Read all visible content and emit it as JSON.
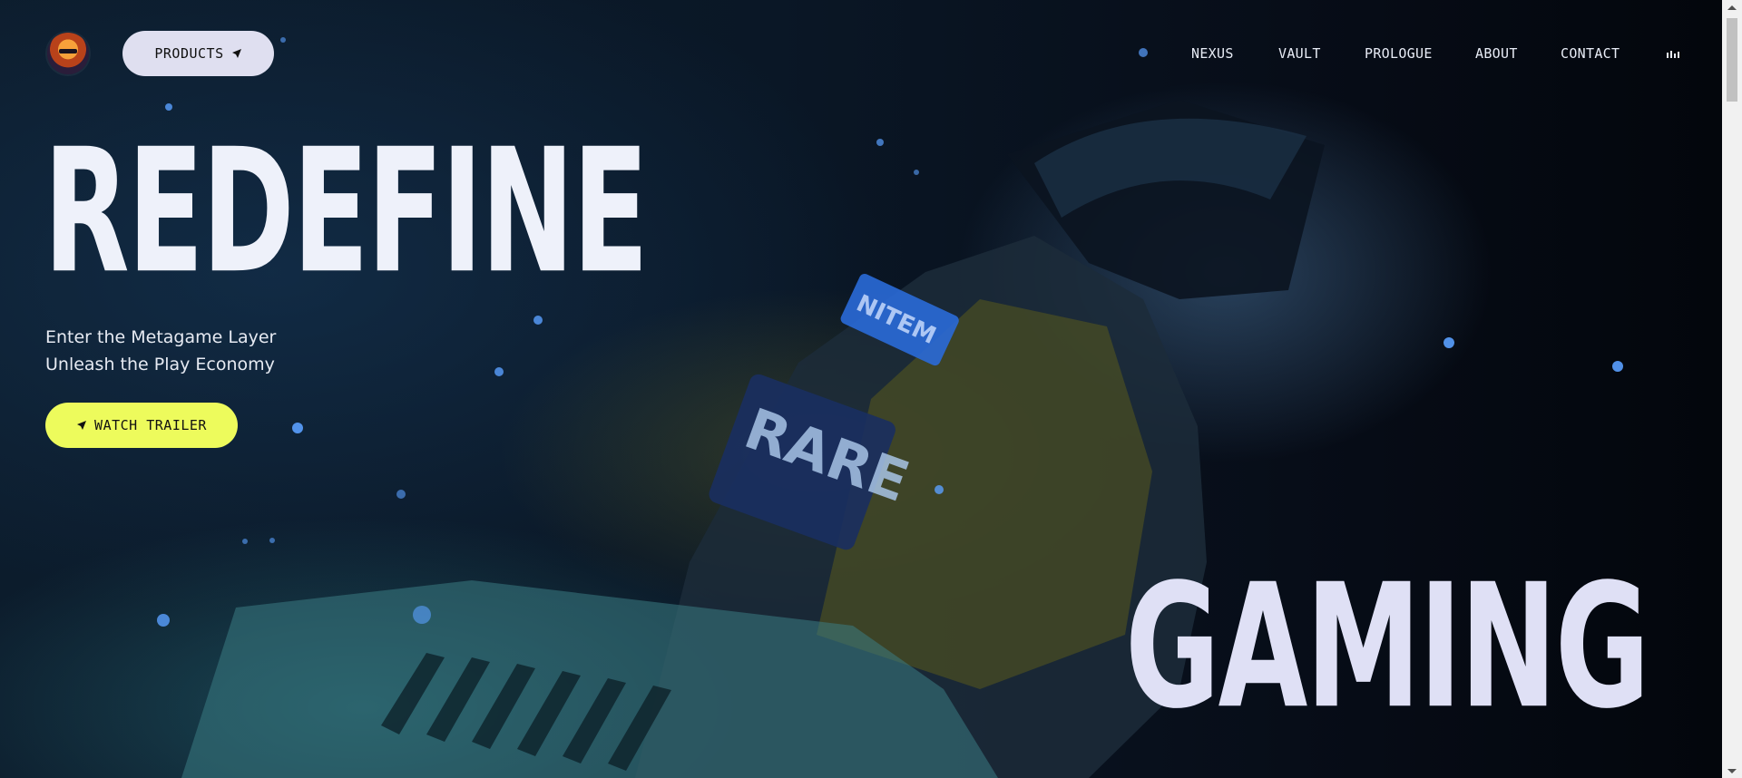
{
  "colors": {
    "heading_primary": "#eef1fa",
    "heading_secondary": "#dfe0f5",
    "products_button_bg": "#dfdff0",
    "trailer_button_bg": "#edfb5c",
    "nav_text": "#e8ecf6"
  },
  "header": {
    "logo_icon": "ninja-avatar-icon",
    "products_label": "PRODUCTS",
    "products_icon": "arrow-icon",
    "nav": [
      "NEXUS",
      "VAULT",
      "PROLOGUE",
      "ABOUT",
      "CONTACT"
    ],
    "audio_icon": "audio-bars-icon"
  },
  "hero": {
    "headline_top": "REDEFINE",
    "headline_bottom": "GAMING",
    "subtitle_line1": "Enter the Metagame Layer",
    "subtitle_line2": "Unleash the Play Economy",
    "cta_label": "WATCH TRAILER",
    "cta_icon": "arrow-icon",
    "armband_text_1": "NITEM",
    "armband_text_2": "RARE"
  }
}
